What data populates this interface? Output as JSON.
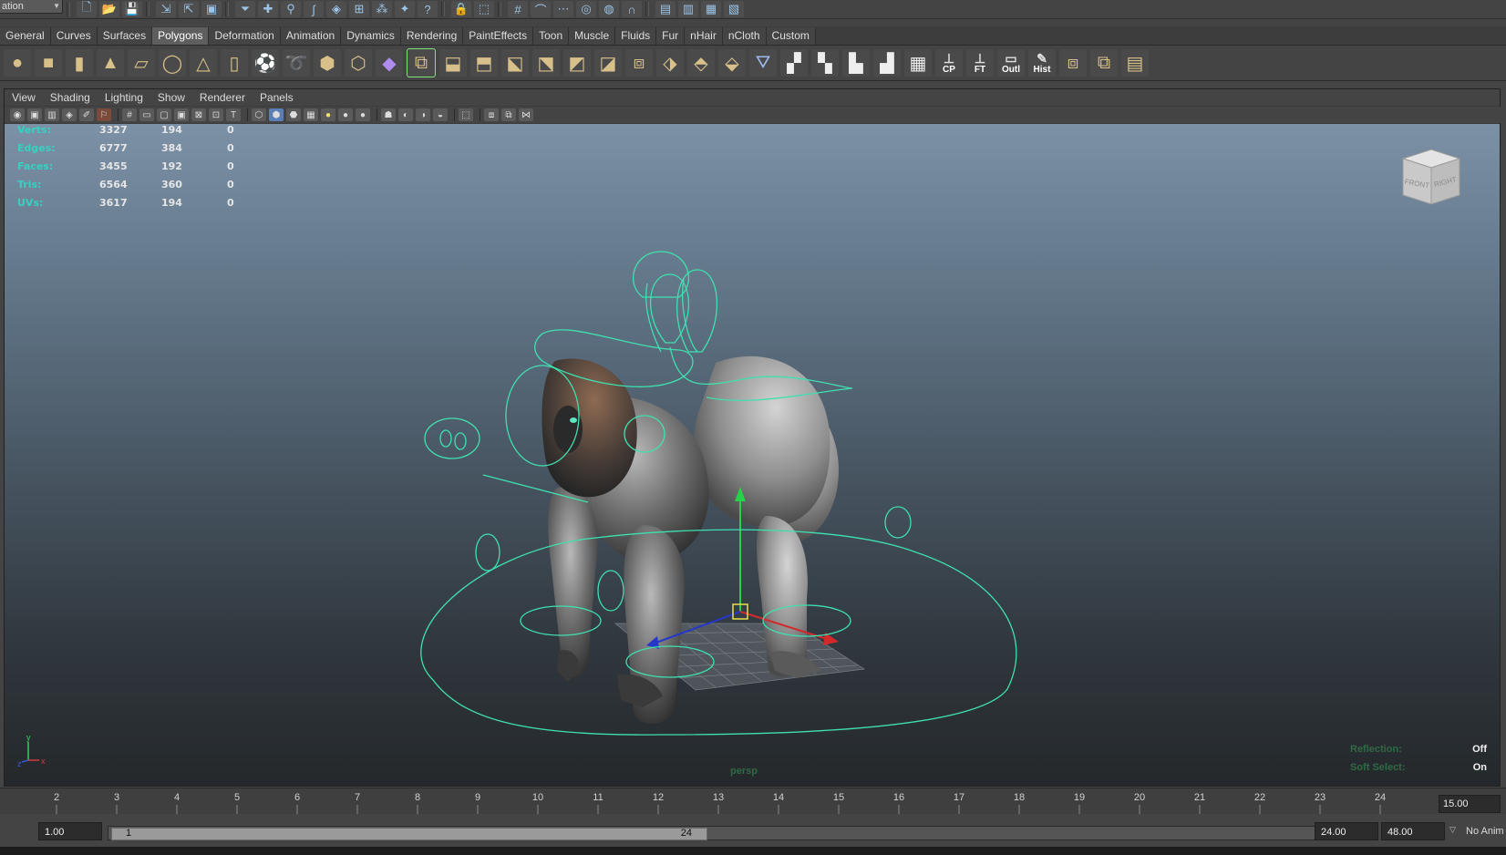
{
  "status_line": {
    "mode_menu": "ation"
  },
  "shelf_tabs": [
    "General",
    "Curves",
    "Surfaces",
    "Polygons",
    "Deformation",
    "Animation",
    "Dynamics",
    "Rendering",
    "PaintEffects",
    "Toon",
    "Muscle",
    "Fluids",
    "Fur",
    "nHair",
    "nCloth",
    "Custom"
  ],
  "shelf_active_tab": "Polygons",
  "shelf_text_buttons": {
    "cp": "CP",
    "ft": "FT",
    "outliner": "Outl",
    "history": "Hist"
  },
  "panel_menu": [
    "View",
    "Shading",
    "Lighting",
    "Show",
    "Renderer",
    "Panels"
  ],
  "hud": {
    "rows": [
      {
        "label": "Verts:",
        "total": "3327",
        "selected": "194",
        "third": "0"
      },
      {
        "label": "Edges:",
        "total": "6777",
        "selected": "384",
        "third": "0"
      },
      {
        "label": "Faces:",
        "total": "3455",
        "selected": "192",
        "third": "0"
      },
      {
        "label": "Tris:",
        "total": "6564",
        "selected": "360",
        "third": "0"
      },
      {
        "label": "UVs:",
        "total": "3617",
        "selected": "194",
        "third": "0"
      }
    ],
    "camera": "persp",
    "reflection_label": "Reflection:",
    "reflection_value": "Off",
    "soft_select_label": "Soft Select:",
    "soft_select_value": "On"
  },
  "viewcube": {
    "front": "FRONT",
    "right": "RIGHT"
  },
  "axis": {
    "x": "x",
    "y": "y",
    "z": "z"
  },
  "timeline": {
    "ticks": [
      "2",
      "3",
      "4",
      "5",
      "6",
      "7",
      "8",
      "9",
      "10",
      "11",
      "12",
      "13",
      "14",
      "15",
      "16",
      "17",
      "18",
      "19",
      "20",
      "21",
      "22",
      "23",
      "24"
    ],
    "current_frame": "15.00"
  },
  "range": {
    "start_time": "1.00",
    "range_start": "1",
    "range_end": "24",
    "end_time": "24.00",
    "anim_end": "48.00",
    "anim_layer": "No Anim"
  },
  "colors": {
    "hud_label": "#36d1c0",
    "rig_controls": "#3fe0b0",
    "active_tab": "#5e5e5e"
  }
}
